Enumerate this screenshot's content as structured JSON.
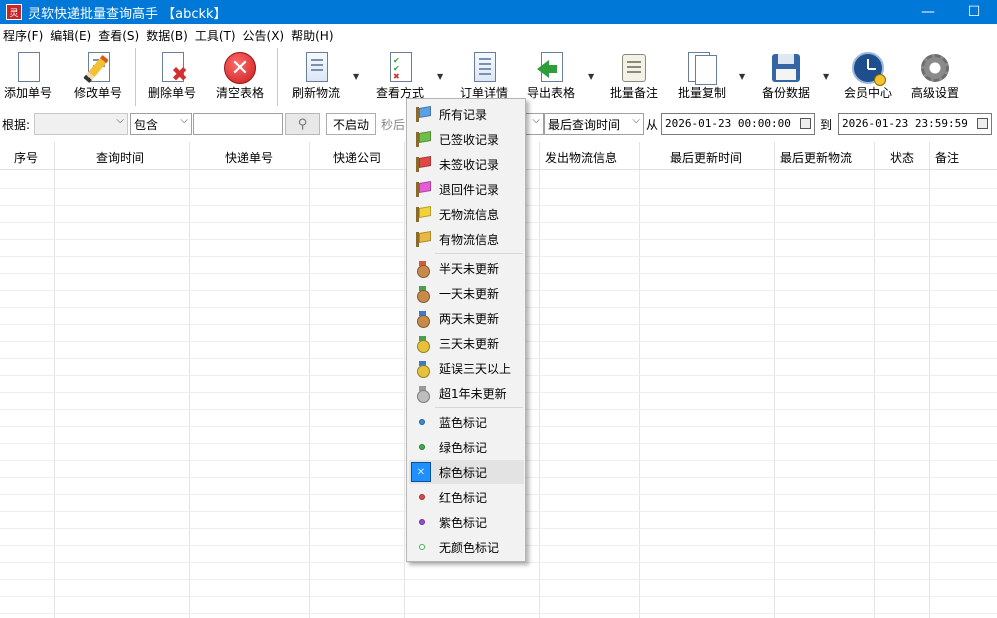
{
  "window": {
    "title": "灵软快递批量查询高手 【abckk】",
    "minimize_glyph": "—",
    "maximize_glyph": "☐"
  },
  "menu": [
    "程序(F)",
    "编辑(E)",
    "查看(S)",
    "数据(B)",
    "工具(T)",
    "公告(X)",
    "帮助(H)"
  ],
  "toolbar": {
    "add": "添加单号",
    "edit": "修改单号",
    "delete": "删除单号",
    "clear": "清空表格",
    "refresh": "刷新物流",
    "view_mode": "查看方式",
    "order_detail": "订单详情",
    "export": "导出表格",
    "batch_note": "批量备注",
    "batch_copy": "批量复制",
    "backup": "备份数据",
    "member": "会员中心",
    "advanced": "高级设置"
  },
  "filter": {
    "label": "根据:",
    "field_value": "",
    "match_value": "包含",
    "keyword": "",
    "search_icon": "magnifier-icon",
    "timer_button": "不启动",
    "interval_text": "秒后",
    "time_field": "最后查询时间",
    "from_label": "从",
    "from_value": "2026-01-23 00:00:00",
    "to_label": "到",
    "to_value": "2026-01-23 23:59:59"
  },
  "grid": {
    "columns": [
      "序号",
      "查询时间",
      "快递单号",
      "快递公司",
      "发出物流信息",
      "最后更新时间",
      "最后更新物流",
      "状态",
      "备注"
    ]
  },
  "popup_menu": {
    "group1": [
      {
        "label": "所有记录",
        "color": "#5aa0e6"
      },
      {
        "label": "已签收记录",
        "color": "#6cc04a"
      },
      {
        "label": "未签收记录",
        "color": "#e04848"
      },
      {
        "label": "退回件记录",
        "color": "#e65bd6"
      },
      {
        "label": "无物流信息",
        "color": "#f2d23a"
      },
      {
        "label": "有物流信息",
        "color": "#e8b840"
      }
    ],
    "group2": [
      {
        "label": "半天未更新",
        "color": "#c88a4a",
        "ribbon": "#d65a3a"
      },
      {
        "label": "一天未更新",
        "color": "#c88a4a",
        "ribbon": "#4aa04a"
      },
      {
        "label": "两天未更新",
        "color": "#c88a4a",
        "ribbon": "#3a7ad6"
      },
      {
        "label": "三天未更新",
        "color": "#e6c23a",
        "ribbon": "#4aa04a"
      },
      {
        "label": "延误三天以上",
        "color": "#e6c23a",
        "ribbon": "#3a7ad6"
      },
      {
        "label": "超1年未更新",
        "color": "#bdbdbd",
        "ribbon": "#9a9a9a"
      }
    ],
    "group3": [
      {
        "label": "蓝色标记",
        "color": "#3a8ad6"
      },
      {
        "label": "绿色标记",
        "color": "#3ab04a"
      },
      {
        "label": "棕色标记",
        "color": "#1e90ff",
        "selected": true
      },
      {
        "label": "红色标记",
        "color": "#e04848"
      },
      {
        "label": "紫色标记",
        "color": "#9a4ad6"
      },
      {
        "label": "无颜色标记",
        "color": "#3ab04a",
        "hollow": true
      }
    ]
  }
}
